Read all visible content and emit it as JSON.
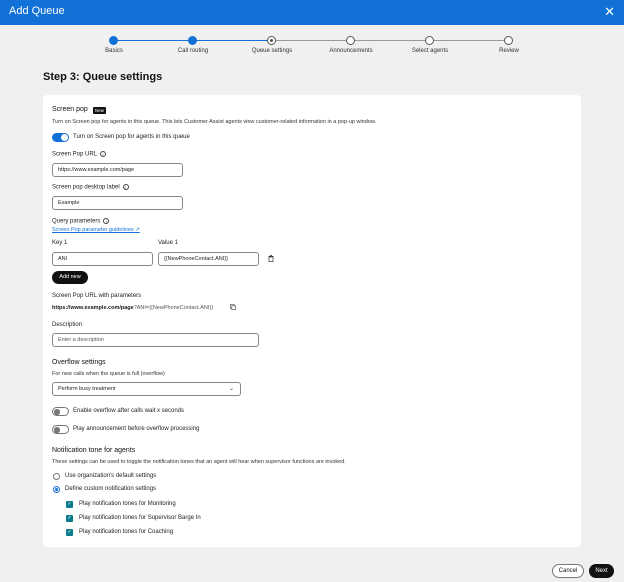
{
  "header": {
    "title": "Add Queue",
    "close_icon": "close-icon"
  },
  "stepper": {
    "steps": [
      {
        "label": "Basics",
        "state": "done"
      },
      {
        "label": "Call routing",
        "state": "done"
      },
      {
        "label": "Queue settings",
        "state": "current"
      },
      {
        "label": "Announcements",
        "state": "todo"
      },
      {
        "label": "Select agents",
        "state": "todo"
      },
      {
        "label": "Review",
        "state": "todo"
      }
    ]
  },
  "page_title": "Step 3: Queue settings",
  "screen_pop": {
    "title": "Screen pop",
    "badge": "New",
    "description": "Turn on Screen pop for agents in this queue. This lets Customer Assist agents view customer-related information in a pop-up window.",
    "toggle_label": "Turn on Screen pop for agents in this queue",
    "toggle_on": true,
    "url_label": "Screen Pop URL",
    "url_value": "https://www.example.com/page",
    "desktop_label_label": "Screen pop desktop label",
    "desktop_label_value": "Example",
    "query_params_label": "Query parameters",
    "guidelines_link": "Screen Pop parameter guidelines",
    "key_label": "Key 1",
    "value_label": "Value 1",
    "key_value": "ANI",
    "value_value": "{{NewPhoneContact.ANI}}",
    "add_new_label": "Add new",
    "url_with_params_label": "Screen Pop URL with parameters",
    "url_with_params_base": "https://www.example.com/page",
    "url_with_params_query": "?ANI={{NewPhoneContact.ANI}}",
    "description_label": "Description",
    "description_placeholder": "Enter a description"
  },
  "overflow": {
    "title": "Overflow settings",
    "subtitle": "For new calls when the queue is full (overflow)",
    "select_value": "Perform busy treatment",
    "toggle1_label": "Enable overflow after calls wait x seconds",
    "toggle2_label": "Play announcement before overflow processing"
  },
  "notification": {
    "title": "Notification tone for agents",
    "subtitle": "These settings can be used to toggle the notification tones that an agent will hear when supervisor functions are invoked.",
    "radio_default": "Use organization's default settings",
    "radio_custom": "Define custom notification settings",
    "check_monitoring": "Play notification tones for Monitoring",
    "check_barge": "Play notification tones for Supervisor Barge In",
    "check_coaching": "Play notification tones for Coaching"
  },
  "footer": {
    "cancel_label": "Cancel",
    "next_label": "Next"
  },
  "colors": {
    "accent": "#1271d6",
    "checkbox": "#0a7c8c"
  }
}
